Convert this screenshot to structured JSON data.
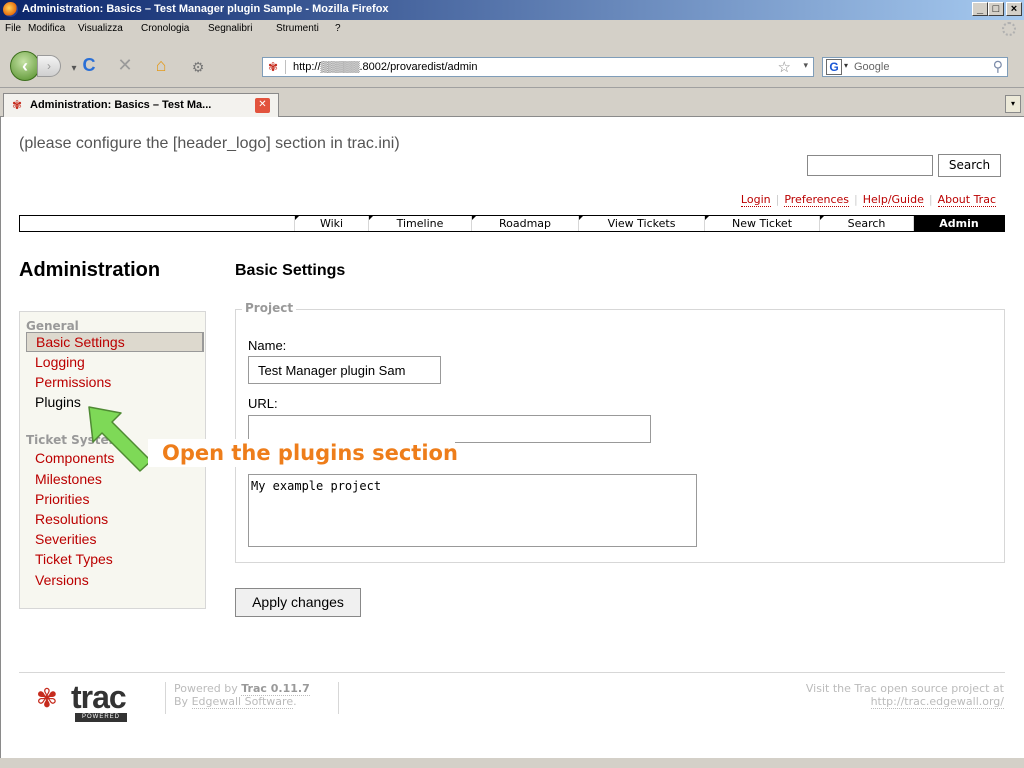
{
  "window": {
    "title": "Administration: Basics – Test Manager plugin Sample - Mozilla Firefox",
    "buttons": {
      "minimize": "_",
      "maximize": "□",
      "close": "×"
    }
  },
  "menubar": [
    "File",
    "Modifica",
    "Visualizza",
    "Cronologia",
    "Segnalibri",
    "Strumenti",
    "?"
  ],
  "navbar": {
    "url": "http://▒▒▒▒▒.8002/provaredist/admin",
    "search_placeholder": "Google"
  },
  "tab": {
    "label": "Administration: Basics – Test Ma..."
  },
  "trac": {
    "header_logo_note": "(please configure the [header_logo] section in trac.ini)",
    "search_button": "Search",
    "metanav": [
      "Login",
      "Preferences",
      "Help/Guide",
      "About Trac"
    ],
    "mainnav": [
      "Wiki",
      "Timeline",
      "Roadmap",
      "View Tickets",
      "New Ticket",
      "Search",
      "Admin"
    ],
    "mainnav_active": "Admin",
    "admin_title": "Administration",
    "panel_title": "Basic Settings",
    "sidebar": {
      "group_general": "General",
      "general_items": [
        "Basic Settings",
        "Logging",
        "Permissions",
        "Plugins"
      ],
      "group_ticket": "Ticket System",
      "ticket_items": [
        "Components",
        "Milestones",
        "Priorities",
        "Resolutions",
        "Severities",
        "Ticket Types",
        "Versions"
      ]
    },
    "form": {
      "legend": "Project",
      "name_label": "Name:",
      "name_value": "Test Manager plugin Sam",
      "url_label": "URL:",
      "url_value": "",
      "desc_value": "My example project",
      "apply_button": "Apply changes"
    },
    "footer": {
      "logo_word": "trac",
      "logo_badge": "POWERED",
      "powered_by": "Powered by",
      "trac_version": "Trac 0.11.7",
      "by": "By",
      "edgewall": "Edgewall Software",
      "visit_text": "Visit the Trac open source project at",
      "visit_url": "http://trac.edgewall.org/"
    }
  },
  "callout": {
    "text": "Open the plugins section",
    "color": "#ee7d1a",
    "arrow_color": "#7ed957"
  }
}
